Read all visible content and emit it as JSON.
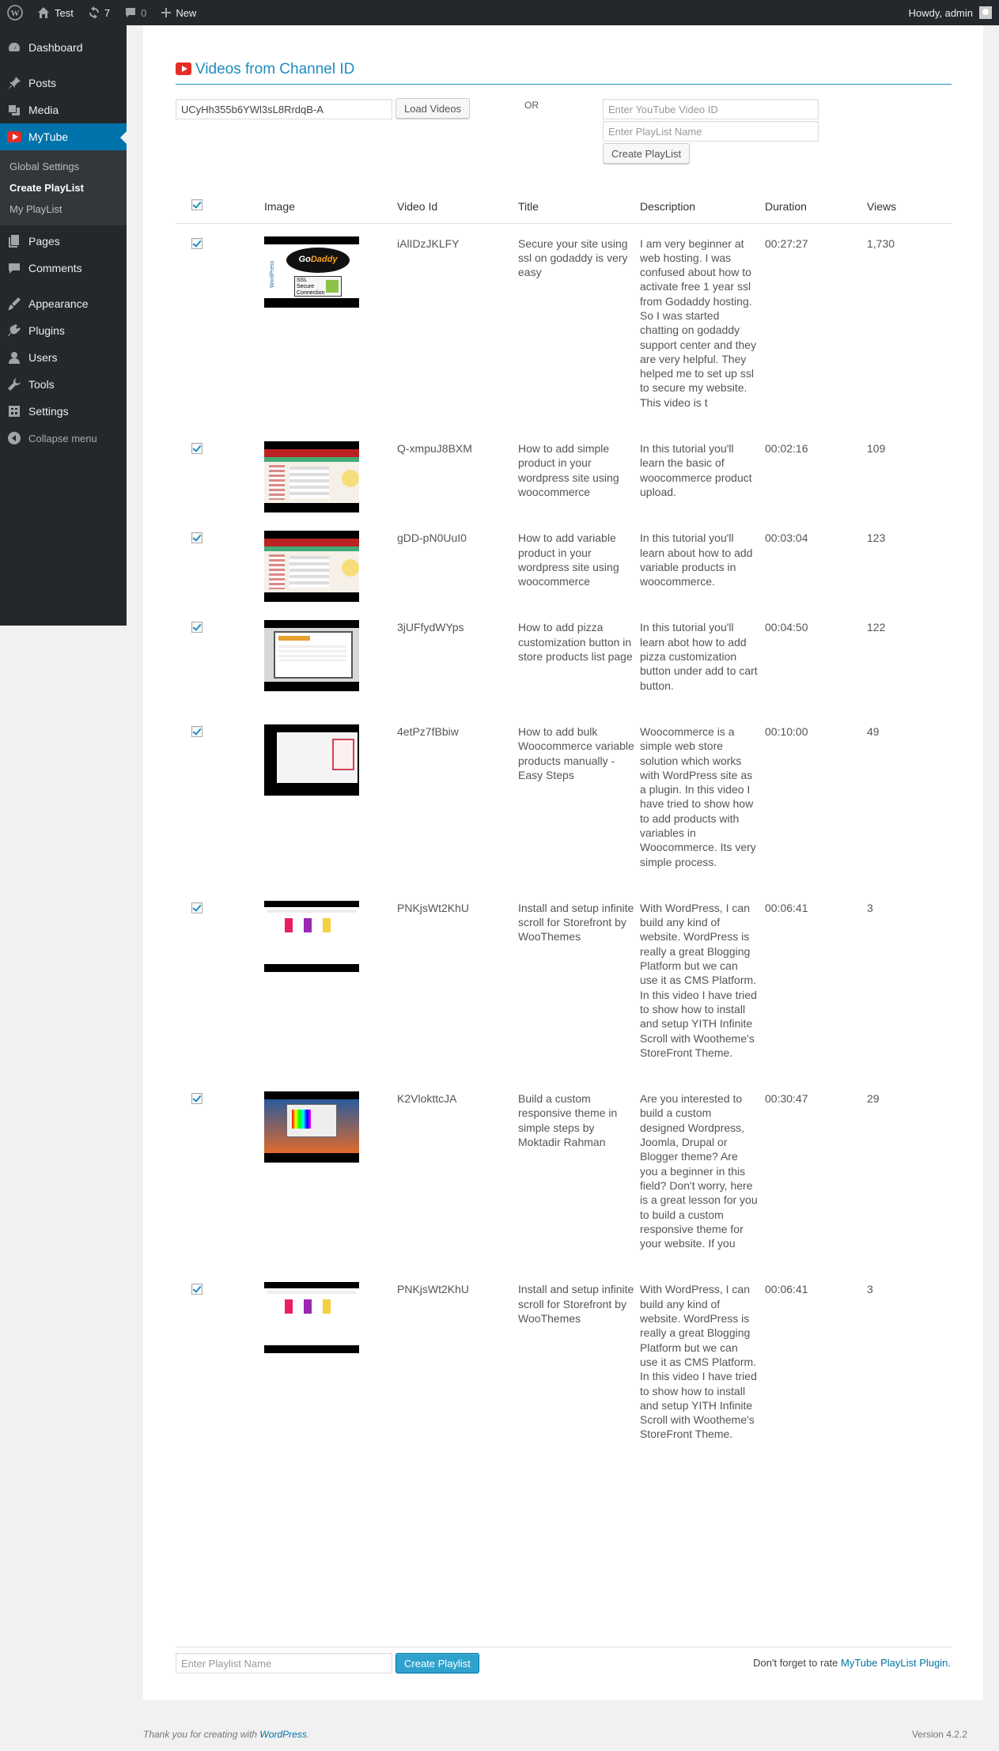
{
  "adminbar": {
    "site_name": "Test",
    "updates_count": "7",
    "comments_count": "0",
    "new_label": "New",
    "howdy": "Howdy, admin"
  },
  "sidebar": {
    "items": [
      {
        "label": "Dashboard",
        "icon": "dashboard-icon"
      },
      {
        "label": "Posts",
        "icon": "pin-icon"
      },
      {
        "label": "Media",
        "icon": "media-icon"
      },
      {
        "label": "MyTube",
        "icon": "youtube-icon"
      }
    ],
    "submenu": [
      "Global Settings",
      "Create PlayList",
      "My PlayList"
    ],
    "items2": [
      {
        "label": "Pages",
        "icon": "pages-icon"
      },
      {
        "label": "Comments",
        "icon": "comments-icon"
      }
    ],
    "items3": [
      {
        "label": "Appearance",
        "icon": "appearance-icon"
      },
      {
        "label": "Plugins",
        "icon": "plugins-icon"
      },
      {
        "label": "Users",
        "icon": "users-icon"
      },
      {
        "label": "Tools",
        "icon": "tools-icon"
      },
      {
        "label": "Settings",
        "icon": "settings-icon"
      }
    ],
    "collapse": "Collapse menu"
  },
  "page": {
    "title": "Videos from Channel ID",
    "channel_id_value": "UCyHh355b6YWl3sL8RrdqB-A",
    "load_videos_label": "Load Videos",
    "or_label": "OR",
    "video_id_placeholder": "Enter YouTube Video ID",
    "playlist_name_placeholder": "Enter PlayList Name",
    "create_playlist_top_label": "Create PlayList"
  },
  "table": {
    "headers": {
      "image": "Image",
      "video_id": "Video Id",
      "title": "Title",
      "description": "Description",
      "duration": "Duration",
      "views": "Views"
    },
    "rows": [
      {
        "video_id": "iAlIDzJKLFY",
        "title": "Secure your site using ssl on godaddy is very easy",
        "description": "I am very beginner at web hosting. I was confused about how to activate free 1 year ssl from Godaddy hosting. So I was started chatting on godaddy support center and they are very helpful. They helped me to set up ssl to secure my website. This video is t",
        "duration": "00:27:27",
        "views": "1,730",
        "thumb": "godaddy"
      },
      {
        "video_id": "Q-xmpuJ8BXM",
        "title": "How to add simple product in your wordpress site using woocommerce",
        "description": "In this tutorial you'll learn the basic of woocommerce product upload.",
        "duration": "00:02:16",
        "views": "109",
        "thumb": "shop"
      },
      {
        "video_id": "gDD-pN0UuI0",
        "title": "How to add variable product in your wordpress site using woocommerce",
        "description": "In this tutorial you'll learn about how to add variable products in woocommerce.",
        "duration": "00:03:04",
        "views": "123",
        "thumb": "shop"
      },
      {
        "video_id": "3jUFfydWYps",
        "title": "How to add pizza customization button in store products list page",
        "description": "In this tutorial you'll learn abot how to add pizza customization button under add to cart button.",
        "duration": "00:04:50",
        "views": "122",
        "thumb": "gray"
      },
      {
        "video_id": "4etPz7fBbiw",
        "title": "How to add bulk Woocommerce variable products manually - Easy Steps",
        "description": "Woocommerce is a simple web store solution which works with WordPress site as a plugin. In this video I have tried to show how to add products with variables in Woocommerce. Its very simple process.",
        "duration": "00:10:00",
        "views": "49",
        "thumb": "bulk"
      },
      {
        "video_id": "PNKjsWt2KhU",
        "title": "Install and setup infinite scroll for Storefront by WooThemes",
        "description": "With WordPress, I can build any kind of website. WordPress is really a great Blogging Platform but we can use it as CMS Platform. In this video I have tried to show how to install and setup YITH Infinite Scroll with Wootheme's StoreFront Theme.",
        "duration": "00:06:41",
        "views": "3",
        "thumb": "infinite"
      },
      {
        "video_id": "K2VlokttcJA",
        "title": "Build a custom responsive theme in simple steps by Moktadir Rahman",
        "description": "Are you interested to build a custom designed Wordpress, Joomla, Drupal or Blogger theme? Are you a beginner in this field? Don't worry, here is a great lesson for you to build a custom responsive theme for your website. If you",
        "duration": "00:30:47",
        "views": "29",
        "thumb": "builder"
      },
      {
        "video_id": "PNKjsWt2KhU",
        "title": "Install and setup infinite scroll for Storefront by WooThemes",
        "description": "With WordPress, I can build any kind of website. WordPress is really a great Blogging Platform but we can use it as CMS Platform. In this video I have tried to show how to install and setup YITH Infinite Scroll with Wootheme's StoreFront Theme.",
        "duration": "00:06:41",
        "views": "3",
        "thumb": "infinite"
      }
    ]
  },
  "bottom": {
    "playlist_placeholder": "Enter Playlist Name",
    "create_label": "Create Playlist",
    "rate_prefix": "Don't forget to rate ",
    "rate_link": "MyTube PlayList Plugin",
    "rate_suffix": "."
  },
  "footer": {
    "thanks_prefix": "Thank you for creating with ",
    "thanks_link": "WordPress",
    "thanks_suffix": ".",
    "version": "Version 4.2.2"
  },
  "colors": {
    "accent": "#0073aa",
    "heading": "#1e8cbe",
    "sidebar_bg": "#23282d",
    "youtube_red": "#e52d27"
  }
}
